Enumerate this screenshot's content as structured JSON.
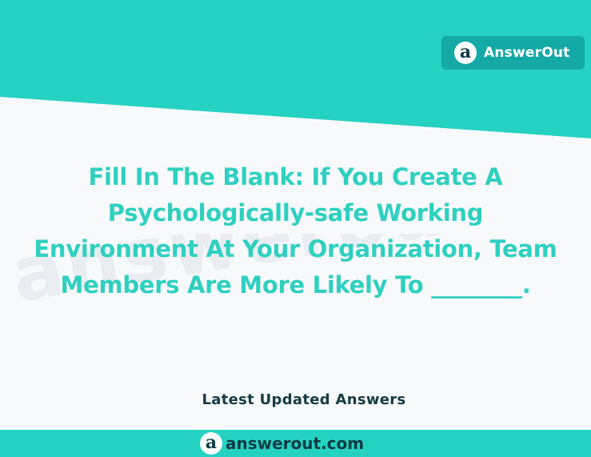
{
  "colors": {
    "accent_teal": "#25d2c2",
    "badge_teal": "#14a9a5",
    "question_text": "#2fd0c0",
    "dark_text": "#143b45",
    "background": "#f8f9fb"
  },
  "brand": {
    "logo_icon": "a-circle-logo-icon",
    "logo_glyph": "a",
    "name": "AnswerOut"
  },
  "watermark": {
    "text": "answerout.com"
  },
  "question": {
    "lines": [
      "Fill In The Blank: If You Create A",
      "Psychologically-safe Working",
      "Environment At Your Organization, Team",
      "Members Are More Likely To ________."
    ]
  },
  "tagline": "Latest Updated Answers",
  "footer": {
    "logo_icon": "a-circle-logo-icon",
    "logo_glyph": "a",
    "site": "answerout.com"
  }
}
